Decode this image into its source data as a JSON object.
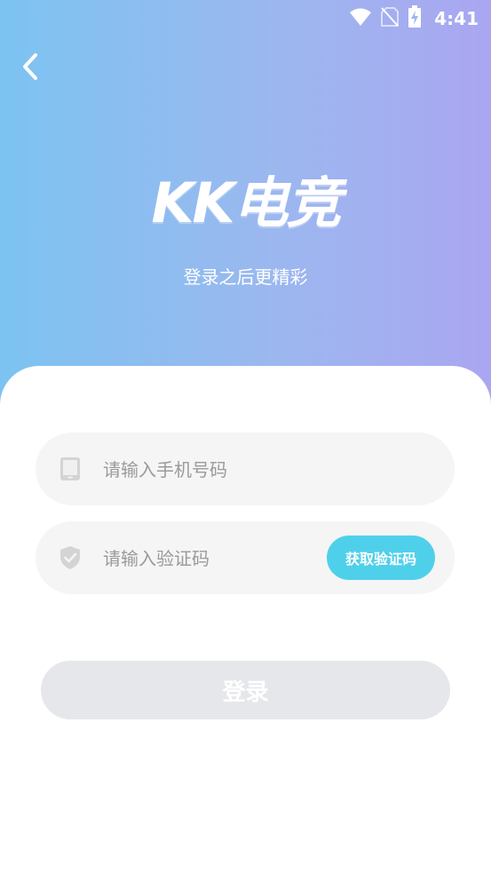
{
  "status_bar": {
    "time": "4:41"
  },
  "header": {
    "logo_text": "KK电竞",
    "subtitle": "登录之后更精彩"
  },
  "form": {
    "phone_placeholder": "请输入手机号码",
    "code_placeholder": "请输入验证码",
    "get_code_label": "获取验证码",
    "login_label": "登录"
  },
  "icons": {
    "back": "chevron-left-icon",
    "phone": "phone-icon",
    "shield": "shield-check-icon",
    "wifi": "wifi-icon",
    "no_sim": "no-sim-icon",
    "battery": "battery-charging-icon"
  },
  "colors": {
    "gradient_start": "#7cc3f1",
    "gradient_end": "#aaa6f1",
    "code_button": "#4fd0ea",
    "login_button_disabled": "#e6e7ea",
    "field_bg": "#f5f5f5"
  }
}
